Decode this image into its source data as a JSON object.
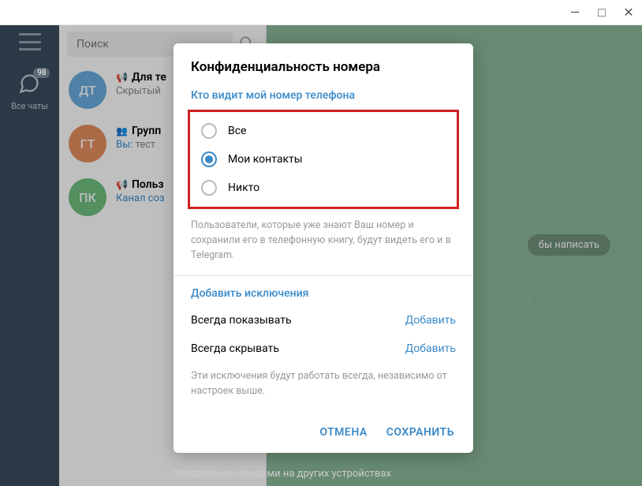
{
  "titlebar": {
    "minimize": "—",
    "maximize": "□",
    "close": "✕"
  },
  "sidebar": {
    "badge": "98",
    "allchats": "Все чаты"
  },
  "search": {
    "placeholder": "Поиск"
  },
  "chats": [
    {
      "avatar": "ДТ",
      "title": "Для те",
      "sub": "Скрытый"
    },
    {
      "avatar": "ГТ",
      "title": "Групп",
      "you": "Вы:",
      "sub": " тест"
    },
    {
      "avatar": "ПК",
      "title": "Польз",
      "sub": "Канал соз"
    }
  ],
  "hint": "бы написать",
  "dialog": {
    "title": "Конфиденциальность номера",
    "section1": "Кто видит мой номер телефона",
    "options": [
      {
        "label": "Все",
        "checked": false
      },
      {
        "label": "Мои контакты",
        "checked": true
      },
      {
        "label": "Никто",
        "checked": false
      }
    ],
    "desc1": "Пользователи, которые уже знают Ваш номер и сохранили его в телефонную книгу, будут видеть его и в Telegram.",
    "section2": "Добавить исключения",
    "exc": [
      {
        "label": "Всегда показывать",
        "action": "Добавить"
      },
      {
        "label": "Всегда скрывать",
        "action": "Добавить"
      }
    ],
    "desc2": "Эти исключения будут работать всегда, независимо от настроек выше.",
    "cancel": "ОТМЕНА",
    "save": "СОХРАНИТЬ"
  },
  "footer": "Управление сеансами на других устройствах"
}
